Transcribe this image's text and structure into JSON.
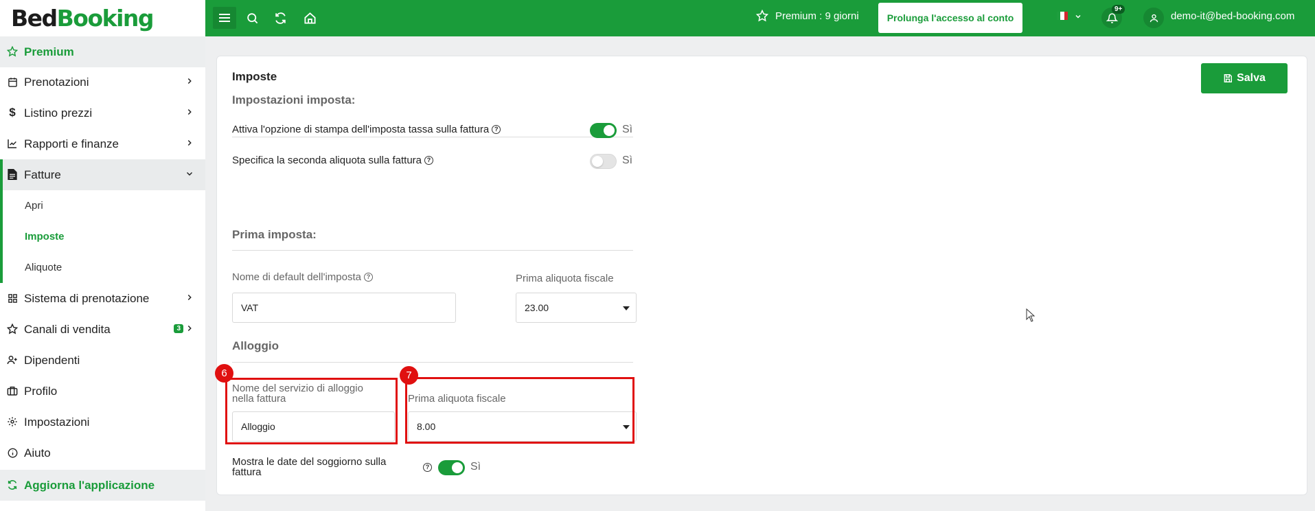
{
  "brand": {
    "part1": "Bed",
    "part2": "Booking"
  },
  "sidebar": {
    "premium": "Premium",
    "items": [
      {
        "label": "Prenotazioni"
      },
      {
        "label": "Listino prezzi"
      },
      {
        "label": "Rapporti e finanze"
      },
      {
        "label": "Fatture"
      },
      {
        "label": "Sistema di prenotazione"
      },
      {
        "label": "Canali di vendita",
        "badge": "3"
      },
      {
        "label": "Dipendenti"
      },
      {
        "label": "Profilo"
      },
      {
        "label": "Impostazioni"
      },
      {
        "label": "Aiuto"
      }
    ],
    "sub_items": [
      {
        "label": "Apri"
      },
      {
        "label": "Imposte"
      },
      {
        "label": "Aliquote"
      }
    ],
    "update": "Aggiorna l'applicazione"
  },
  "topbar": {
    "premium_text": "Premium : 9 giorni",
    "extend_button": "Prolunga l'accesso al conto",
    "notifications_badge": "9+",
    "user_email": "demo-it@bed-booking.com"
  },
  "page": {
    "title": "Imposte",
    "save_button": "Salva",
    "tax_settings": {
      "heading": "Impostazioni imposta:",
      "print_tax_label": "Attiva l'opzione di stampa dell'imposta tassa sulla fattura",
      "print_tax_value": "Sì",
      "second_rate_label": "Specifica la seconda aliquota sulla fattura",
      "second_rate_value": "Sì"
    },
    "first_tax": {
      "heading": "Prima imposta:",
      "name_label": "Nome di default dell'imposta",
      "name_value": "VAT",
      "rate_label": "Prima aliquota fiscale",
      "rate_value": "23.00"
    },
    "accommodation": {
      "heading": "Alloggio",
      "service_name_label": "Nome del servizio di alloggio nella fattura",
      "service_name_value": "Alloggio",
      "rate_label": "Prima aliquota fiscale",
      "rate_value": "8.00",
      "show_dates_label": "Mostra le date del soggiorno sulla fattura",
      "show_dates_value": "Sì"
    }
  },
  "annotations": {
    "marker_6": "6",
    "marker_7": "7"
  },
  "colors": {
    "brand_green": "#1a9c3a",
    "highlight_red": "#e01010"
  }
}
